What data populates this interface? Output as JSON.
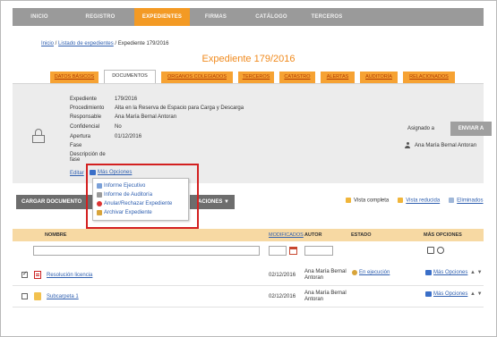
{
  "nav": {
    "items": [
      "INICIO",
      "REGISTRO",
      "EXPEDIENTES",
      "FIRMAS",
      "CATÁLOGO",
      "TERCEROS"
    ],
    "active_index": 2,
    "colors": {
      "bar": "#9a9a9a",
      "active": "#f39a24"
    }
  },
  "breadcrumb": {
    "link1": "Inicio",
    "sep1": " / ",
    "link2": "Listado de expedientes",
    "current": " / Expediente 179/2016"
  },
  "page_title": "Expediente 179/2016",
  "tabs": [
    "DATOS BÁSICOS",
    "DOCUMENTOS",
    "ORGANOS COLEGIADOS",
    "TERCEROS",
    "CATASTRO",
    "ALERTAS",
    "AUDITORÍA",
    "RELACIONADOS"
  ],
  "active_tab_index": 1,
  "details": {
    "fields": [
      {
        "label": "Expediente",
        "value": "179/2016"
      },
      {
        "label": "Procedimiento",
        "value": "Alta en la Reserva de Espacio para Carga y Descarga"
      },
      {
        "label": "Responsable",
        "value": "Ana María Bernal Antoran"
      },
      {
        "label": "Confidencial",
        "value": "No"
      },
      {
        "label": "Apertura",
        "value": "01/12/2016"
      },
      {
        "label": "Fase",
        "value": ""
      },
      {
        "label": "Descripción de fase",
        "value": ""
      }
    ],
    "edit_label": "Editar",
    "more_options_label": "Más Opciones"
  },
  "assignment": {
    "label": "Asignado a",
    "send_button": "ENVIAR A",
    "assignee": "Ana María Bernal Antoran"
  },
  "toolbar": {
    "upload_button": "CARGAR DOCUMENTO",
    "actions_button_suffix": "ACIONES ▼",
    "view_full": "Vista completa",
    "view_reduced": "Vista reducida",
    "deleted": "Eliminados"
  },
  "dropdown": {
    "items": [
      {
        "label": "Informe Ejecutivo",
        "icon": "report-icon"
      },
      {
        "label": "Informe de Auditoría",
        "icon": "audit-icon"
      },
      {
        "label": "Anular/Rechazar Expediente",
        "icon": "cancel-icon"
      },
      {
        "label": "Archivar Expediente",
        "icon": "archive-icon"
      }
    ]
  },
  "table": {
    "headers": {
      "name": "NOMBRE",
      "modified": "MODIFICADOS",
      "author": "AUTOR",
      "status": "ESTADO",
      "more": "MÁS OPCIONES"
    },
    "rows": [
      {
        "checked": true,
        "type": "pdf",
        "name": "Resolución licencia",
        "date": "02/12/2016",
        "author_line1": "Ana María Bernal",
        "author_line2": "Antoran",
        "status": "En ejecución",
        "more": "Más Opciones",
        "arrows": "▲ ▼"
      },
      {
        "checked": false,
        "type": "folder",
        "name": "Subcarpeta 1",
        "date": "02/12/2016",
        "author_line1": "Ana María Bernal",
        "author_line2": "Antoran",
        "status": "",
        "more": "Más Opciones",
        "arrows": "▲ ▼"
      }
    ]
  }
}
